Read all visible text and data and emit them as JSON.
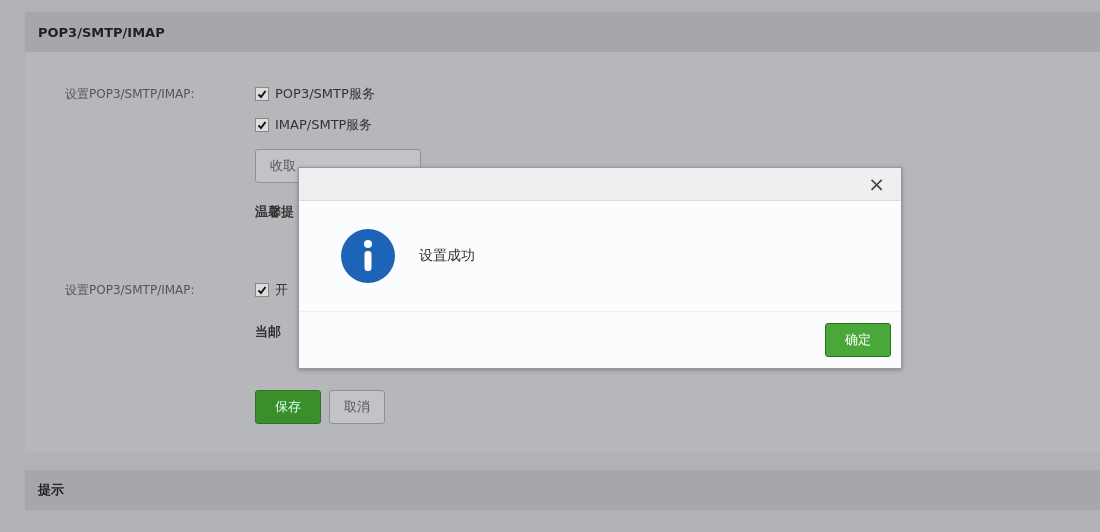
{
  "section": {
    "title": "POP3/SMTP/IMAP"
  },
  "rows": [
    {
      "label": "设置POP3/SMTP/IMAP:",
      "options": [
        {
          "label": "POP3/SMTP服务",
          "checked": true
        },
        {
          "label": "IMAP/SMTP服务",
          "checked": true
        }
      ],
      "button": "收取",
      "note": "温馨提"
    },
    {
      "label": "设置POP3/SMTP/IMAP:",
      "options": [
        {
          "label": "开",
          "checked": true
        }
      ],
      "note": "当邮"
    }
  ],
  "actions": {
    "save": "保存",
    "cancel": "取消"
  },
  "tips": {
    "title": "提示"
  },
  "dialog": {
    "close": "×",
    "message": "设置成功",
    "ok": "确定"
  }
}
